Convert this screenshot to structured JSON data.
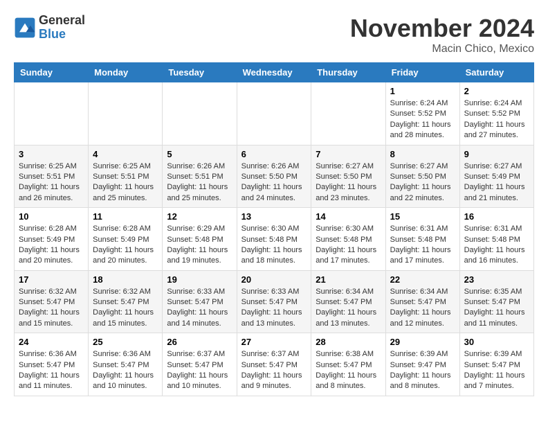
{
  "header": {
    "logo_general": "General",
    "logo_blue": "Blue",
    "month_title": "November 2024",
    "subtitle": "Macin Chico, Mexico"
  },
  "calendar": {
    "days_of_week": [
      "Sunday",
      "Monday",
      "Tuesday",
      "Wednesday",
      "Thursday",
      "Friday",
      "Saturday"
    ],
    "weeks": [
      [
        {
          "day": "",
          "sunrise": "",
          "sunset": "",
          "daylight": ""
        },
        {
          "day": "",
          "sunrise": "",
          "sunset": "",
          "daylight": ""
        },
        {
          "day": "",
          "sunrise": "",
          "sunset": "",
          "daylight": ""
        },
        {
          "day": "",
          "sunrise": "",
          "sunset": "",
          "daylight": ""
        },
        {
          "day": "",
          "sunrise": "",
          "sunset": "",
          "daylight": ""
        },
        {
          "day": "1",
          "sunrise": "Sunrise: 6:24 AM",
          "sunset": "Sunset: 5:52 PM",
          "daylight": "Daylight: 11 hours and 28 minutes."
        },
        {
          "day": "2",
          "sunrise": "Sunrise: 6:24 AM",
          "sunset": "Sunset: 5:52 PM",
          "daylight": "Daylight: 11 hours and 27 minutes."
        }
      ],
      [
        {
          "day": "3",
          "sunrise": "Sunrise: 6:25 AM",
          "sunset": "Sunset: 5:51 PM",
          "daylight": "Daylight: 11 hours and 26 minutes."
        },
        {
          "day": "4",
          "sunrise": "Sunrise: 6:25 AM",
          "sunset": "Sunset: 5:51 PM",
          "daylight": "Daylight: 11 hours and 25 minutes."
        },
        {
          "day": "5",
          "sunrise": "Sunrise: 6:26 AM",
          "sunset": "Sunset: 5:51 PM",
          "daylight": "Daylight: 11 hours and 25 minutes."
        },
        {
          "day": "6",
          "sunrise": "Sunrise: 6:26 AM",
          "sunset": "Sunset: 5:50 PM",
          "daylight": "Daylight: 11 hours and 24 minutes."
        },
        {
          "day": "7",
          "sunrise": "Sunrise: 6:27 AM",
          "sunset": "Sunset: 5:50 PM",
          "daylight": "Daylight: 11 hours and 23 minutes."
        },
        {
          "day": "8",
          "sunrise": "Sunrise: 6:27 AM",
          "sunset": "Sunset: 5:50 PM",
          "daylight": "Daylight: 11 hours and 22 minutes."
        },
        {
          "day": "9",
          "sunrise": "Sunrise: 6:27 AM",
          "sunset": "Sunset: 5:49 PM",
          "daylight": "Daylight: 11 hours and 21 minutes."
        }
      ],
      [
        {
          "day": "10",
          "sunrise": "Sunrise: 6:28 AM",
          "sunset": "Sunset: 5:49 PM",
          "daylight": "Daylight: 11 hours and 20 minutes."
        },
        {
          "day": "11",
          "sunrise": "Sunrise: 6:28 AM",
          "sunset": "Sunset: 5:49 PM",
          "daylight": "Daylight: 11 hours and 20 minutes."
        },
        {
          "day": "12",
          "sunrise": "Sunrise: 6:29 AM",
          "sunset": "Sunset: 5:48 PM",
          "daylight": "Daylight: 11 hours and 19 minutes."
        },
        {
          "day": "13",
          "sunrise": "Sunrise: 6:30 AM",
          "sunset": "Sunset: 5:48 PM",
          "daylight": "Daylight: 11 hours and 18 minutes."
        },
        {
          "day": "14",
          "sunrise": "Sunrise: 6:30 AM",
          "sunset": "Sunset: 5:48 PM",
          "daylight": "Daylight: 11 hours and 17 minutes."
        },
        {
          "day": "15",
          "sunrise": "Sunrise: 6:31 AM",
          "sunset": "Sunset: 5:48 PM",
          "daylight": "Daylight: 11 hours and 17 minutes."
        },
        {
          "day": "16",
          "sunrise": "Sunrise: 6:31 AM",
          "sunset": "Sunset: 5:48 PM",
          "daylight": "Daylight: 11 hours and 16 minutes."
        }
      ],
      [
        {
          "day": "17",
          "sunrise": "Sunrise: 6:32 AM",
          "sunset": "Sunset: 5:47 PM",
          "daylight": "Daylight: 11 hours and 15 minutes."
        },
        {
          "day": "18",
          "sunrise": "Sunrise: 6:32 AM",
          "sunset": "Sunset: 5:47 PM",
          "daylight": "Daylight: 11 hours and 15 minutes."
        },
        {
          "day": "19",
          "sunrise": "Sunrise: 6:33 AM",
          "sunset": "Sunset: 5:47 PM",
          "daylight": "Daylight: 11 hours and 14 minutes."
        },
        {
          "day": "20",
          "sunrise": "Sunrise: 6:33 AM",
          "sunset": "Sunset: 5:47 PM",
          "daylight": "Daylight: 11 hours and 13 minutes."
        },
        {
          "day": "21",
          "sunrise": "Sunrise: 6:34 AM",
          "sunset": "Sunset: 5:47 PM",
          "daylight": "Daylight: 11 hours and 13 minutes."
        },
        {
          "day": "22",
          "sunrise": "Sunrise: 6:34 AM",
          "sunset": "Sunset: 5:47 PM",
          "daylight": "Daylight: 11 hours and 12 minutes."
        },
        {
          "day": "23",
          "sunrise": "Sunrise: 6:35 AM",
          "sunset": "Sunset: 5:47 PM",
          "daylight": "Daylight: 11 hours and 11 minutes."
        }
      ],
      [
        {
          "day": "24",
          "sunrise": "Sunrise: 6:36 AM",
          "sunset": "Sunset: 5:47 PM",
          "daylight": "Daylight: 11 hours and 11 minutes."
        },
        {
          "day": "25",
          "sunrise": "Sunrise: 6:36 AM",
          "sunset": "Sunset: 5:47 PM",
          "daylight": "Daylight: 11 hours and 10 minutes."
        },
        {
          "day": "26",
          "sunrise": "Sunrise: 6:37 AM",
          "sunset": "Sunset: 5:47 PM",
          "daylight": "Daylight: 11 hours and 10 minutes."
        },
        {
          "day": "27",
          "sunrise": "Sunrise: 6:37 AM",
          "sunset": "Sunset: 5:47 PM",
          "daylight": "Daylight: 11 hours and 9 minutes."
        },
        {
          "day": "28",
          "sunrise": "Sunrise: 6:38 AM",
          "sunset": "Sunset: 5:47 PM",
          "daylight": "Daylight: 11 hours and 8 minutes."
        },
        {
          "day": "29",
          "sunrise": "Sunrise: 6:39 AM",
          "sunset": "Sunset: 9:47 PM",
          "daylight": "Daylight: 11 hours and 8 minutes."
        },
        {
          "day": "30",
          "sunrise": "Sunrise: 6:39 AM",
          "sunset": "Sunset: 5:47 PM",
          "daylight": "Daylight: 11 hours and 7 minutes."
        }
      ]
    ]
  }
}
